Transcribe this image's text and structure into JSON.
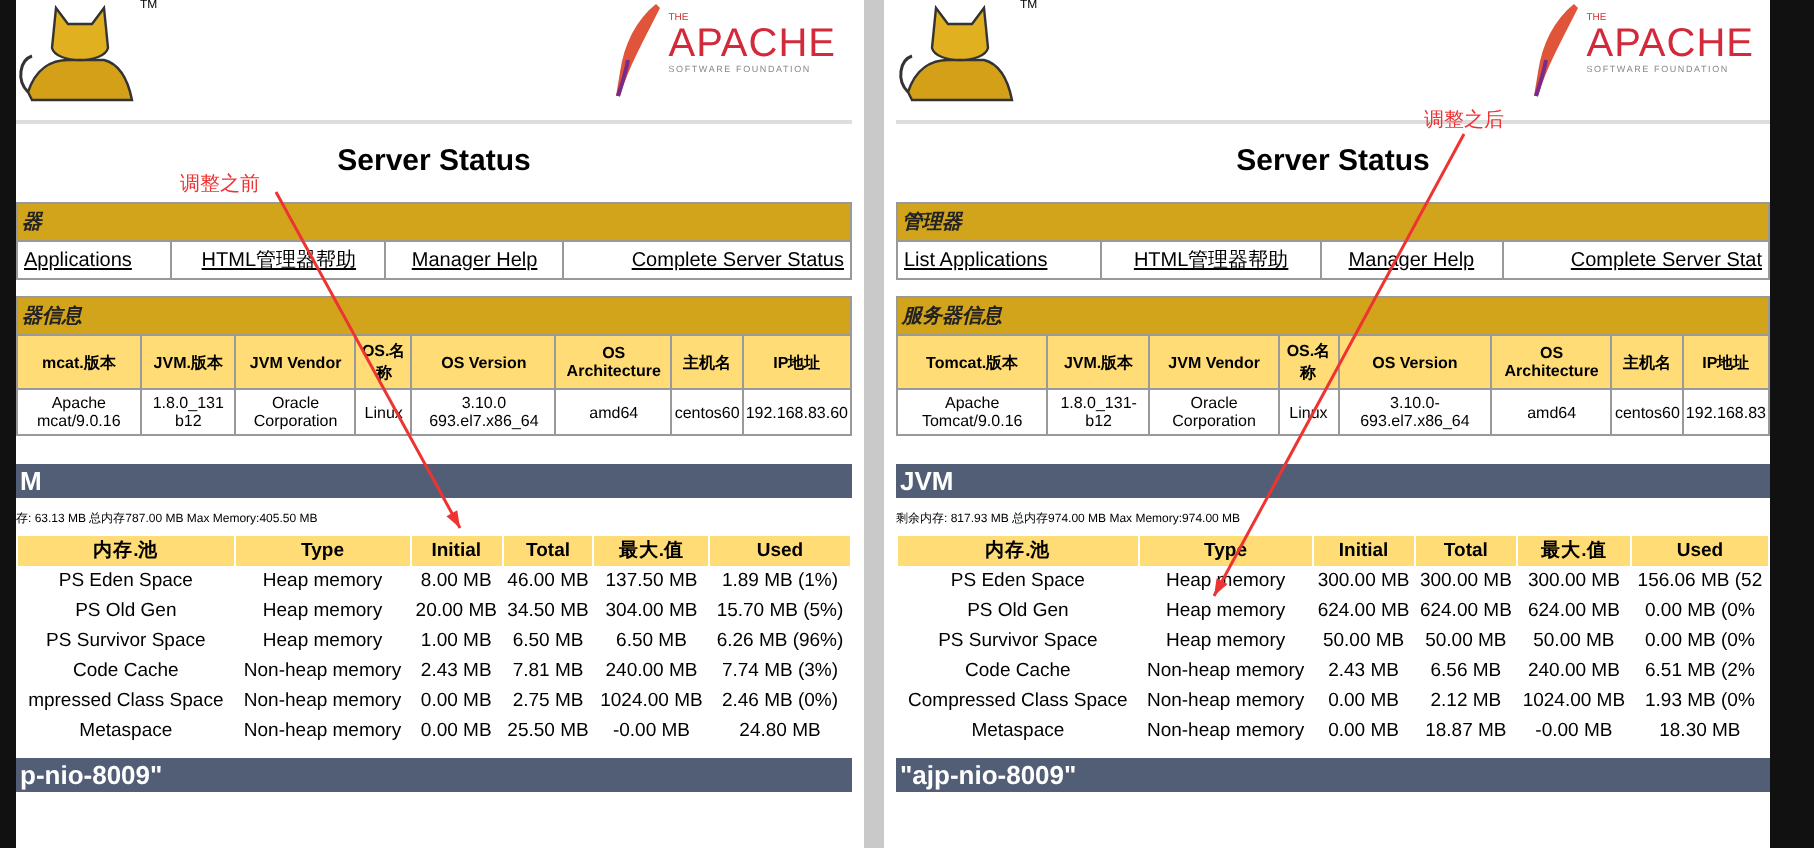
{
  "panels": [
    {
      "tm": "TM",
      "apache": {
        "small": "THE",
        "name": "APACHE",
        "sub": "SOFTWARE FOUNDATION"
      },
      "annotation": "调整之前",
      "title": "Server Status",
      "manager": {
        "heading": "器",
        "links": [
          "Applications",
          "HTML管理器帮助",
          "Manager Help",
          "Complete Server Status"
        ]
      },
      "server_info": {
        "heading": "器信息",
        "columns": [
          "mcat.版本",
          "JVM.版本",
          "JVM Vendor",
          "OS.名称",
          "OS Version",
          "OS Architecture",
          "主机名",
          "IP地址"
        ],
        "row": [
          "Apache mcat/9.0.16",
          "1.8.0_131 b12",
          "Oracle Corporation",
          "Linux",
          "3.10.0 693.el7.x86_64",
          "amd64",
          "centos60",
          "192.168.83.60"
        ]
      },
      "jvm": {
        "heading": "M",
        "memory_info": "存: 63.13 MB 总内存787.00 MB Max Memory:405.50 MB",
        "columns": [
          "内存.池",
          "Type",
          "Initial",
          "Total",
          "最大.值",
          "Used"
        ],
        "rows": [
          [
            "PS Eden Space",
            "Heap memory",
            "8.00 MB",
            "46.00 MB",
            "137.50 MB",
            "1.89 MB (1%)"
          ],
          [
            "PS Old Gen",
            "Heap memory",
            "20.00 MB",
            "34.50 MB",
            "304.00 MB",
            "15.70 MB (5%)"
          ],
          [
            "PS Survivor Space",
            "Heap memory",
            "1.00 MB",
            "6.50 MB",
            "6.50 MB",
            "6.26 MB (96%)"
          ],
          [
            "Code Cache",
            "Non-heap memory",
            "2.43 MB",
            "7.81 MB",
            "240.00 MB",
            "7.74 MB (3%)"
          ],
          [
            "mpressed Class Space",
            "Non-heap memory",
            "0.00 MB",
            "2.75 MB",
            "1024.00 MB",
            "2.46 MB (0%)"
          ],
          [
            "Metaspace",
            "Non-heap memory",
            "0.00 MB",
            "25.50 MB",
            "-0.00 MB",
            "24.80 MB"
          ]
        ]
      },
      "connector": {
        "heading": "p-nio-8009\""
      }
    },
    {
      "tm": "TM",
      "apache": {
        "small": "THE",
        "name": "APACHE",
        "sub": "SOFTWARE FOUNDATION"
      },
      "annotation": "调整之后",
      "title": "Server Status",
      "manager": {
        "heading": "管理器",
        "links": [
          "List Applications",
          "HTML管理器帮助",
          "Manager Help",
          "Complete Server Stat"
        ]
      },
      "server_info": {
        "heading": "服务器信息",
        "columns": [
          "Tomcat.版本",
          "JVM.版本",
          "JVM Vendor",
          "OS.名称",
          "OS Version",
          "OS Architecture",
          "主机名",
          "IP地址"
        ],
        "row": [
          "Apache Tomcat/9.0.16",
          "1.8.0_131-b12",
          "Oracle Corporation",
          "Linux",
          "3.10.0-693.el7.x86_64",
          "amd64",
          "centos60",
          "192.168.83"
        ]
      },
      "jvm": {
        "heading": "JVM",
        "memory_info": "剩余内存: 817.93 MB 总内存974.00 MB Max Memory:974.00 MB",
        "columns": [
          "内存.池",
          "Type",
          "Initial",
          "Total",
          "最大.值",
          "Used"
        ],
        "rows": [
          [
            "PS Eden Space",
            "Heap memory",
            "300.00 MB",
            "300.00 MB",
            "300.00 MB",
            "156.06 MB (52"
          ],
          [
            "PS Old Gen",
            "Heap memory",
            "624.00 MB",
            "624.00 MB",
            "624.00 MB",
            "0.00 MB (0%"
          ],
          [
            "PS Survivor Space",
            "Heap memory",
            "50.00 MB",
            "50.00 MB",
            "50.00 MB",
            "0.00 MB (0%"
          ],
          [
            "Code Cache",
            "Non-heap memory",
            "2.43 MB",
            "6.56 MB",
            "240.00 MB",
            "6.51 MB (2%"
          ],
          [
            "Compressed Class Space",
            "Non-heap memory",
            "0.00 MB",
            "2.12 MB",
            "1024.00 MB",
            "1.93 MB (0%"
          ],
          [
            "Metaspace",
            "Non-heap memory",
            "0.00 MB",
            "18.87 MB",
            "-0.00 MB",
            "18.30 MB"
          ]
        ]
      },
      "connector": {
        "heading": "\"ajp-nio-8009\""
      }
    }
  ]
}
